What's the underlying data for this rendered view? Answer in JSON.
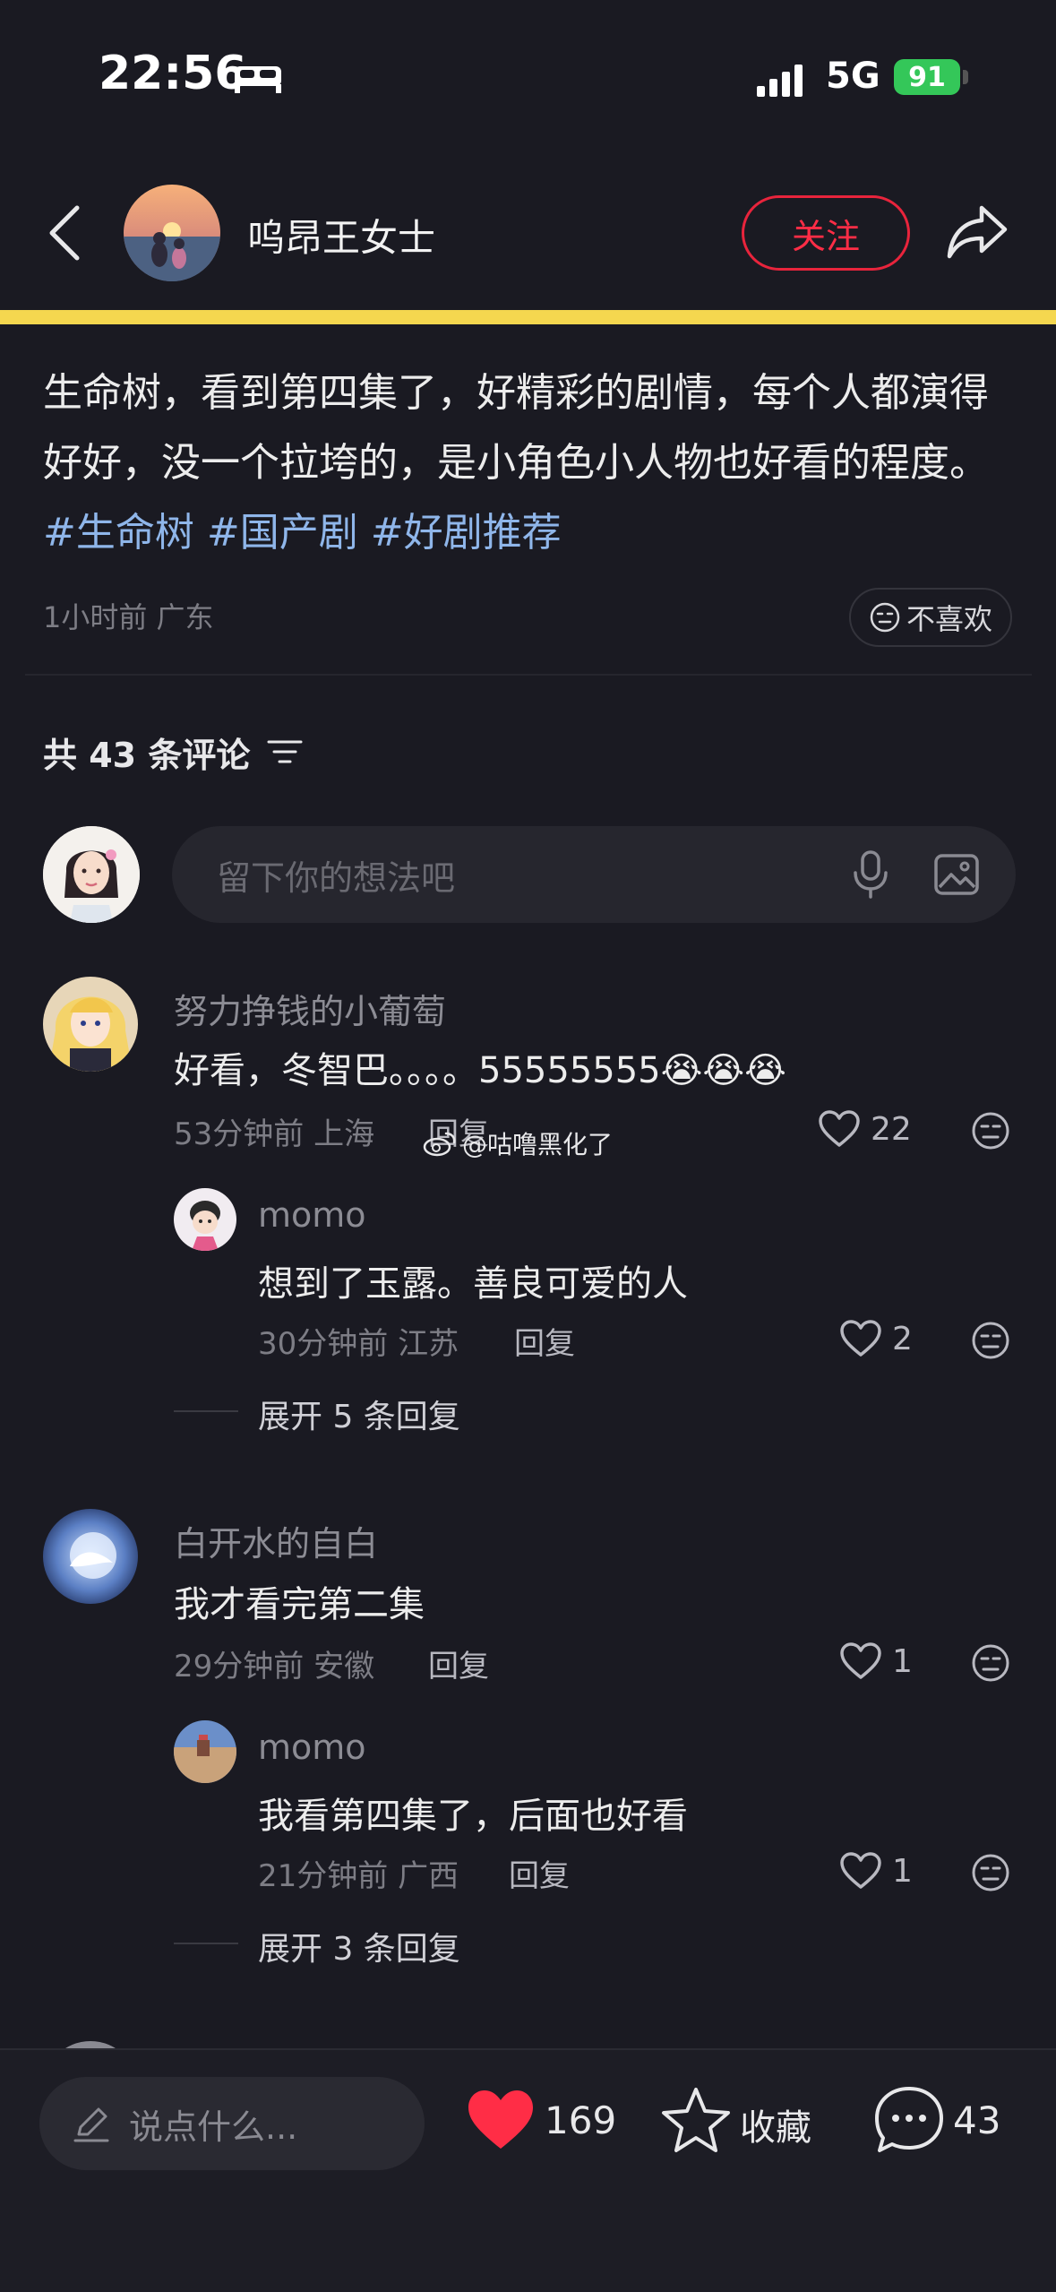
{
  "status_bar": {
    "time": "22:56",
    "network": "5G",
    "battery": "91"
  },
  "header": {
    "username": "呜昂王女士",
    "follow_label": "关注"
  },
  "post": {
    "text": "生命树，看到第四集了，好精彩的剧情，每个人都演得好好，没一个拉垮的，是小角色小人物也好看的程度。",
    "tags": [
      "#生命树",
      "#国产剧",
      "#好剧推荐"
    ],
    "time": "1小时前",
    "location": "广东",
    "dislike_label": "不喜欢"
  },
  "comments_section": {
    "count_label": "共 43 条评论",
    "input_placeholder": "留下你的想法吧"
  },
  "comments": [
    {
      "name": "努力挣钱的小葡萄",
      "text": "好看，冬智巴。。。。55555555",
      "emoji": "😭😭😭",
      "time": "53分钟前",
      "location": "上海",
      "reply_label": "回复",
      "likes": "22",
      "reply": {
        "name": "momo",
        "text": "想到了玉露。善良可爱的人",
        "time": "30分钟前",
        "location": "江苏",
        "reply_label": "回复",
        "likes": "2"
      },
      "expand_label": "展开 5 条回复"
    },
    {
      "name": "白开水的自白",
      "text": "我才看完第二集",
      "time": "29分钟前",
      "location": "安徽",
      "reply_label": "回复",
      "likes": "1",
      "reply": {
        "name": "momo",
        "text": "我看第四集了，后面也好看",
        "time": "21分钟前",
        "location": "广西",
        "reply_label": "回复",
        "likes": "1"
      },
      "expand_label": "展开 3 条回复"
    }
  ],
  "watermark": "@咕噜黑化了",
  "bottom_bar": {
    "input_placeholder": "说点什么...",
    "likes": "169",
    "favorite_label": "收藏",
    "comments": "43"
  },
  "icons": {
    "like_active_color": "#ff2d46",
    "accent_tag_color": "#8fb6ea",
    "header_bar_color": "#f5d74f"
  }
}
